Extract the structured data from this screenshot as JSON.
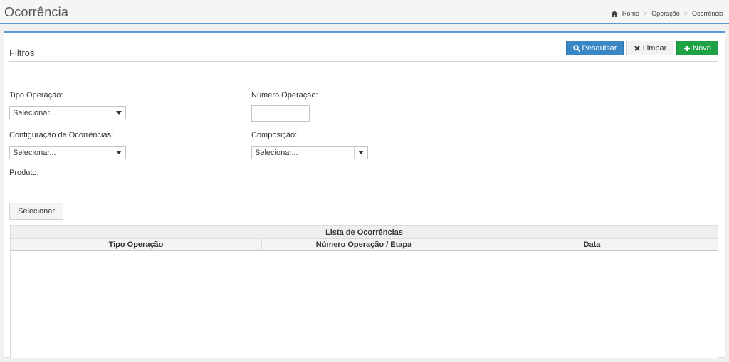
{
  "header": {
    "title": "Ocorrência",
    "breadcrumb": [
      "Home",
      "Operação",
      "Ocorrência"
    ]
  },
  "panel": {
    "title": "Filtros",
    "buttons": {
      "search": "Pesquisar",
      "clear": "Limpar",
      "new": "Novo"
    }
  },
  "filters": {
    "tipo_operacao": {
      "label": "Tipo Operação:",
      "value": "Selecionar..."
    },
    "numero_operacao": {
      "label": "Número Operação:",
      "value": ""
    },
    "config_ocorrencias": {
      "label": "Configuração de Ocorrências:",
      "value": "Selecionar..."
    },
    "composicao": {
      "label": "Composição:",
      "value": "Selecionar..."
    },
    "produto": {
      "label": "Produto:"
    },
    "select_button": "Selecionar"
  },
  "table": {
    "caption": "Lista de Ocorrências",
    "columns": [
      "Tipo Operação",
      "Número Operação / Etapa",
      "Data"
    ],
    "rows": []
  },
  "colors": {
    "accent": "#5b9bd5",
    "primary": "#3a87c5",
    "success": "#1fa245"
  }
}
